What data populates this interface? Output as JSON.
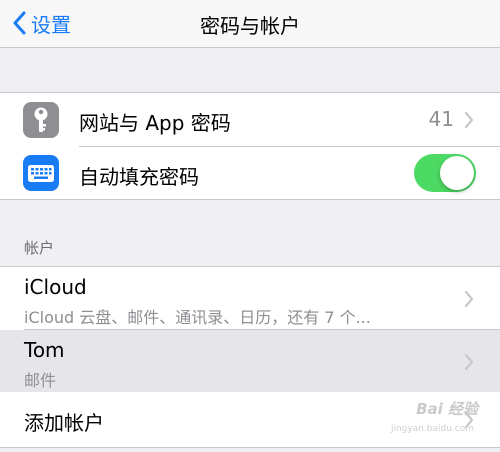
{
  "nav": {
    "back_label": "设置",
    "title": "密码与帐户"
  },
  "passwords_group": {
    "items": [
      {
        "label": "网站与 App 密码",
        "value": "41",
        "icon": "key-icon"
      },
      {
        "label": "自动填充密码",
        "toggle_on": true,
        "icon": "keyboard-icon"
      }
    ]
  },
  "accounts": {
    "header": "帐户",
    "items": [
      {
        "title": "iCloud",
        "subtitle": "iCloud 云盘、邮件、通讯录、日历，还有 7 个..."
      },
      {
        "title": "Tom",
        "subtitle": "邮件"
      },
      {
        "title": "添加帐户"
      }
    ]
  },
  "watermark": {
    "text": "Bai 经验",
    "sub": "jingyan.baidu.com"
  },
  "colors": {
    "accent": "#1a7cf5",
    "toggle_on": "#4cd964",
    "key_icon_bg": "#8e8e93",
    "keyboard_icon_bg": "#1a7cf5",
    "highlight_row": "#e5e5ea"
  }
}
